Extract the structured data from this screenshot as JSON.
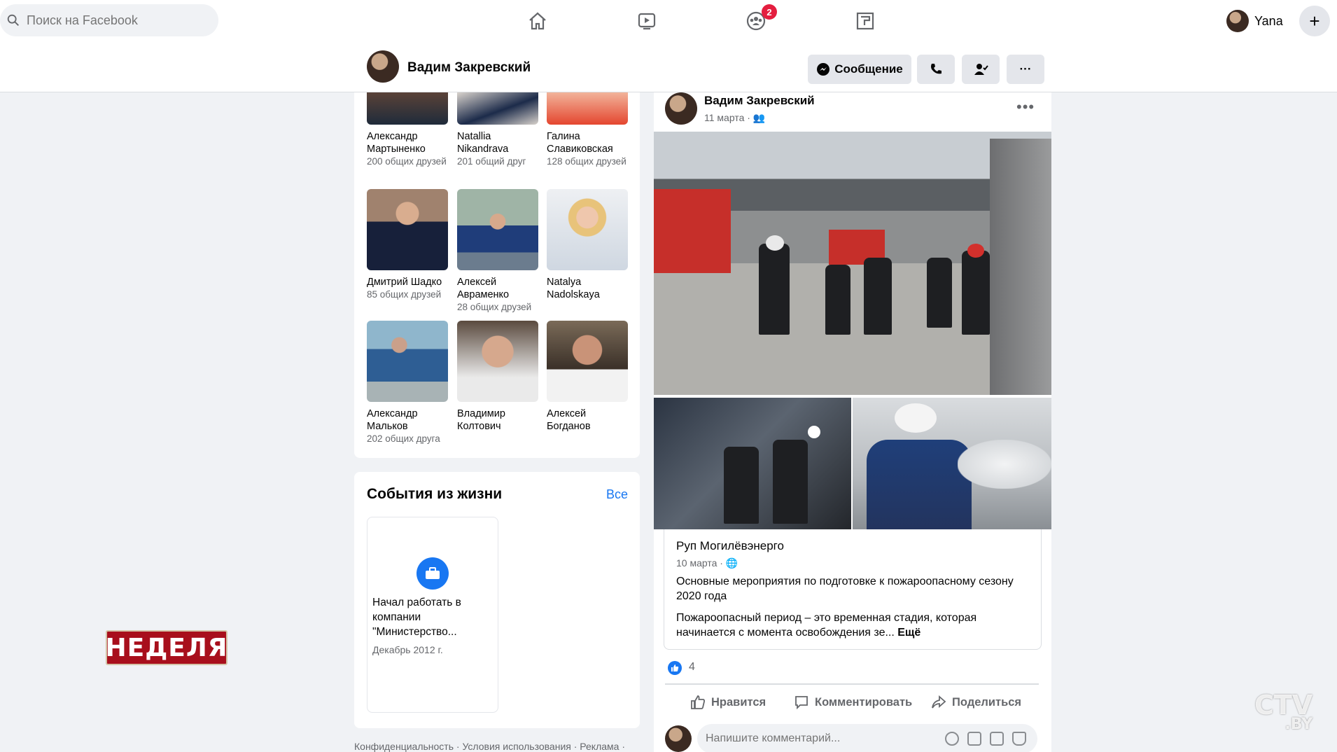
{
  "topbar": {
    "search_placeholder": "Поиск на Facebook",
    "notifications_count": "2",
    "user_name": "Yana",
    "nav_icons": [
      "home-icon",
      "watch-icon",
      "groups-icon",
      "gaming-icon"
    ]
  },
  "profile": {
    "name": "Вадим Закревский",
    "message_label": "Сообщение"
  },
  "friends": [
    {
      "name": "Александр Мартыненко",
      "mutual": "200 общих друзей"
    },
    {
      "name": "Natallia Nikandrava",
      "mutual": "201 общий друг"
    },
    {
      "name": "Галина Славиковская",
      "mutual": "128 общих друзей"
    },
    {
      "name": "Дмитрий Шадко",
      "mutual": "85 общих друзей"
    },
    {
      "name": "Алексей Авраменко",
      "mutual": "28 общих друзей"
    },
    {
      "name": "Natalya Nadolskaya",
      "mutual": ""
    },
    {
      "name": "Александр Мальков",
      "mutual": "202 общих друга"
    },
    {
      "name": "Владимир Колтович",
      "mutual": ""
    },
    {
      "name": "Алексей Богданов",
      "mutual": ""
    }
  ],
  "life_events": {
    "title": "События из жизни",
    "all_label": "Все",
    "item_text": "Начал работать в компании \"Министерство...",
    "item_date": "Декабрь 2012 г."
  },
  "footer": "Конфиденциальность · Условия использования · Реклама ·",
  "post": {
    "author": "Вадим Закревский",
    "date": "11 марта ·",
    "shared": {
      "source": "Руп Могилёвэнерго",
      "date": "10 марта ·",
      "title": "Основные мероприятия по подготовке к пожароопасному сезону 2020 года",
      "body": "Пожароопасный период – это временная стадия, которая начинается с момента освобождения зе...",
      "more": "Ещё"
    },
    "likes": "4",
    "actions": {
      "like": "Нравится",
      "comment": "Комментировать",
      "share": "Поделиться"
    },
    "comment_placeholder": "Напишите комментарий..."
  },
  "overlays": {
    "show_logo": "НЕДЕЛЯ",
    "channel_logo": "CTV",
    "channel_suffix": ".BY"
  },
  "colors": {
    "accent": "#1877f2",
    "badge": "#e41e3f",
    "show_logo_bg": "#a80f1c"
  }
}
